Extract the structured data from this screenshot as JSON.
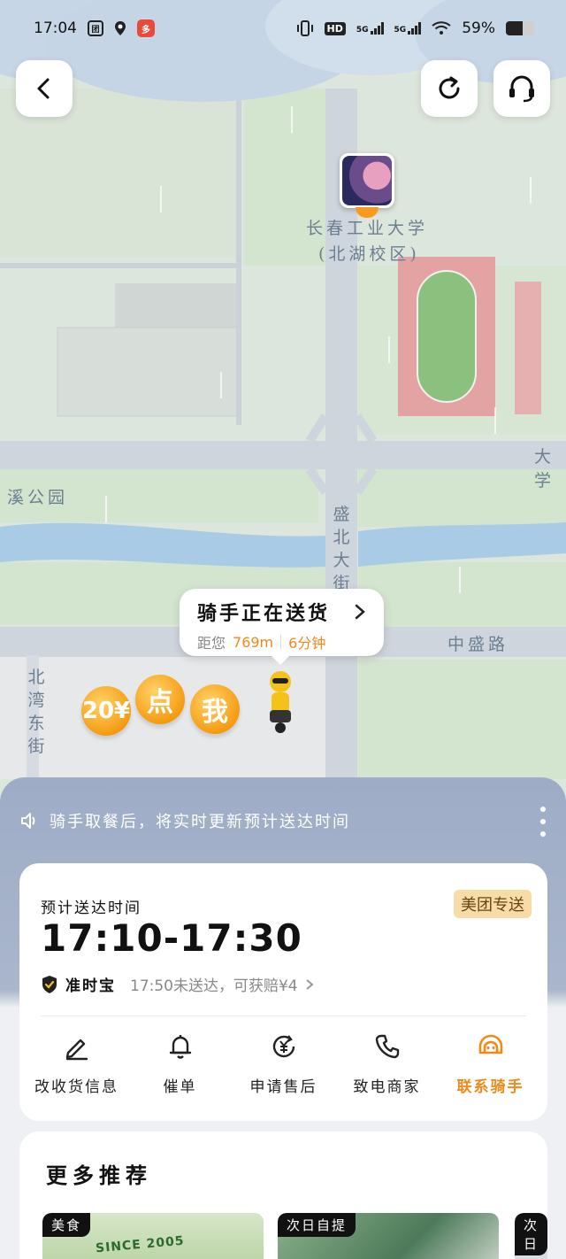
{
  "status_bar": {
    "time": "17:04",
    "battery_text": "59%",
    "battery_level": 0.59,
    "network_1": "5G",
    "network_2": "5G",
    "hd_label": "HD",
    "icons": [
      "notification-box-icon",
      "location-pin-icon",
      "app-badge-icon",
      "vibrate-icon",
      "wifi-icon"
    ]
  },
  "top_bar": {
    "back_icon": "chevron-left-icon",
    "refresh_icon": "refresh-icon",
    "support_icon": "headset-icon"
  },
  "map": {
    "labels": {
      "university": "长春工业大学",
      "campus": "(北湖校区)",
      "road_dxue": "大学",
      "park": "溪公园",
      "street_shengbei": "盛北大街",
      "road_zhongsheng": "中盛路",
      "street_beiwan": "北湾东街"
    },
    "rider_bubble": {
      "title": "骑手正在送货",
      "distance_prefix": "距您",
      "distance": "769m",
      "eta": "6分钟"
    },
    "coins": [
      "20¥",
      "点",
      "我"
    ],
    "colors": {
      "road": "#cfd5dd",
      "water": "#a9cbe6",
      "green": "#d3e5cf",
      "track": "#e3a3a3"
    }
  },
  "notice": {
    "text": "骑手取餐后，将实时更新预计送达时间",
    "icon": "speaker-icon"
  },
  "delivery_card": {
    "eta_label": "预计送达时间",
    "eta_time": "17:10-17:30",
    "badge": "美团专送",
    "guarantee_name": "准时宝",
    "guarantee_text": "17:50未送达，可获赔¥4",
    "actions": [
      {
        "label": "改收货信息",
        "icon": "edit-pencil-icon"
      },
      {
        "label": "催单",
        "icon": "bell-icon"
      },
      {
        "label": "申请售后",
        "icon": "yuan-refund-icon"
      },
      {
        "label": "致电商家",
        "icon": "phone-icon"
      },
      {
        "label": "联系骑手",
        "icon": "rider-helmet-icon"
      }
    ],
    "accent": "#f0891a"
  },
  "recommend": {
    "title": "更多推荐",
    "tiles": [
      {
        "tag": "美食",
        "logo_text": "SINCE 2005"
      },
      {
        "tag": "次日自提"
      },
      {
        "tag": "次日"
      }
    ]
  }
}
